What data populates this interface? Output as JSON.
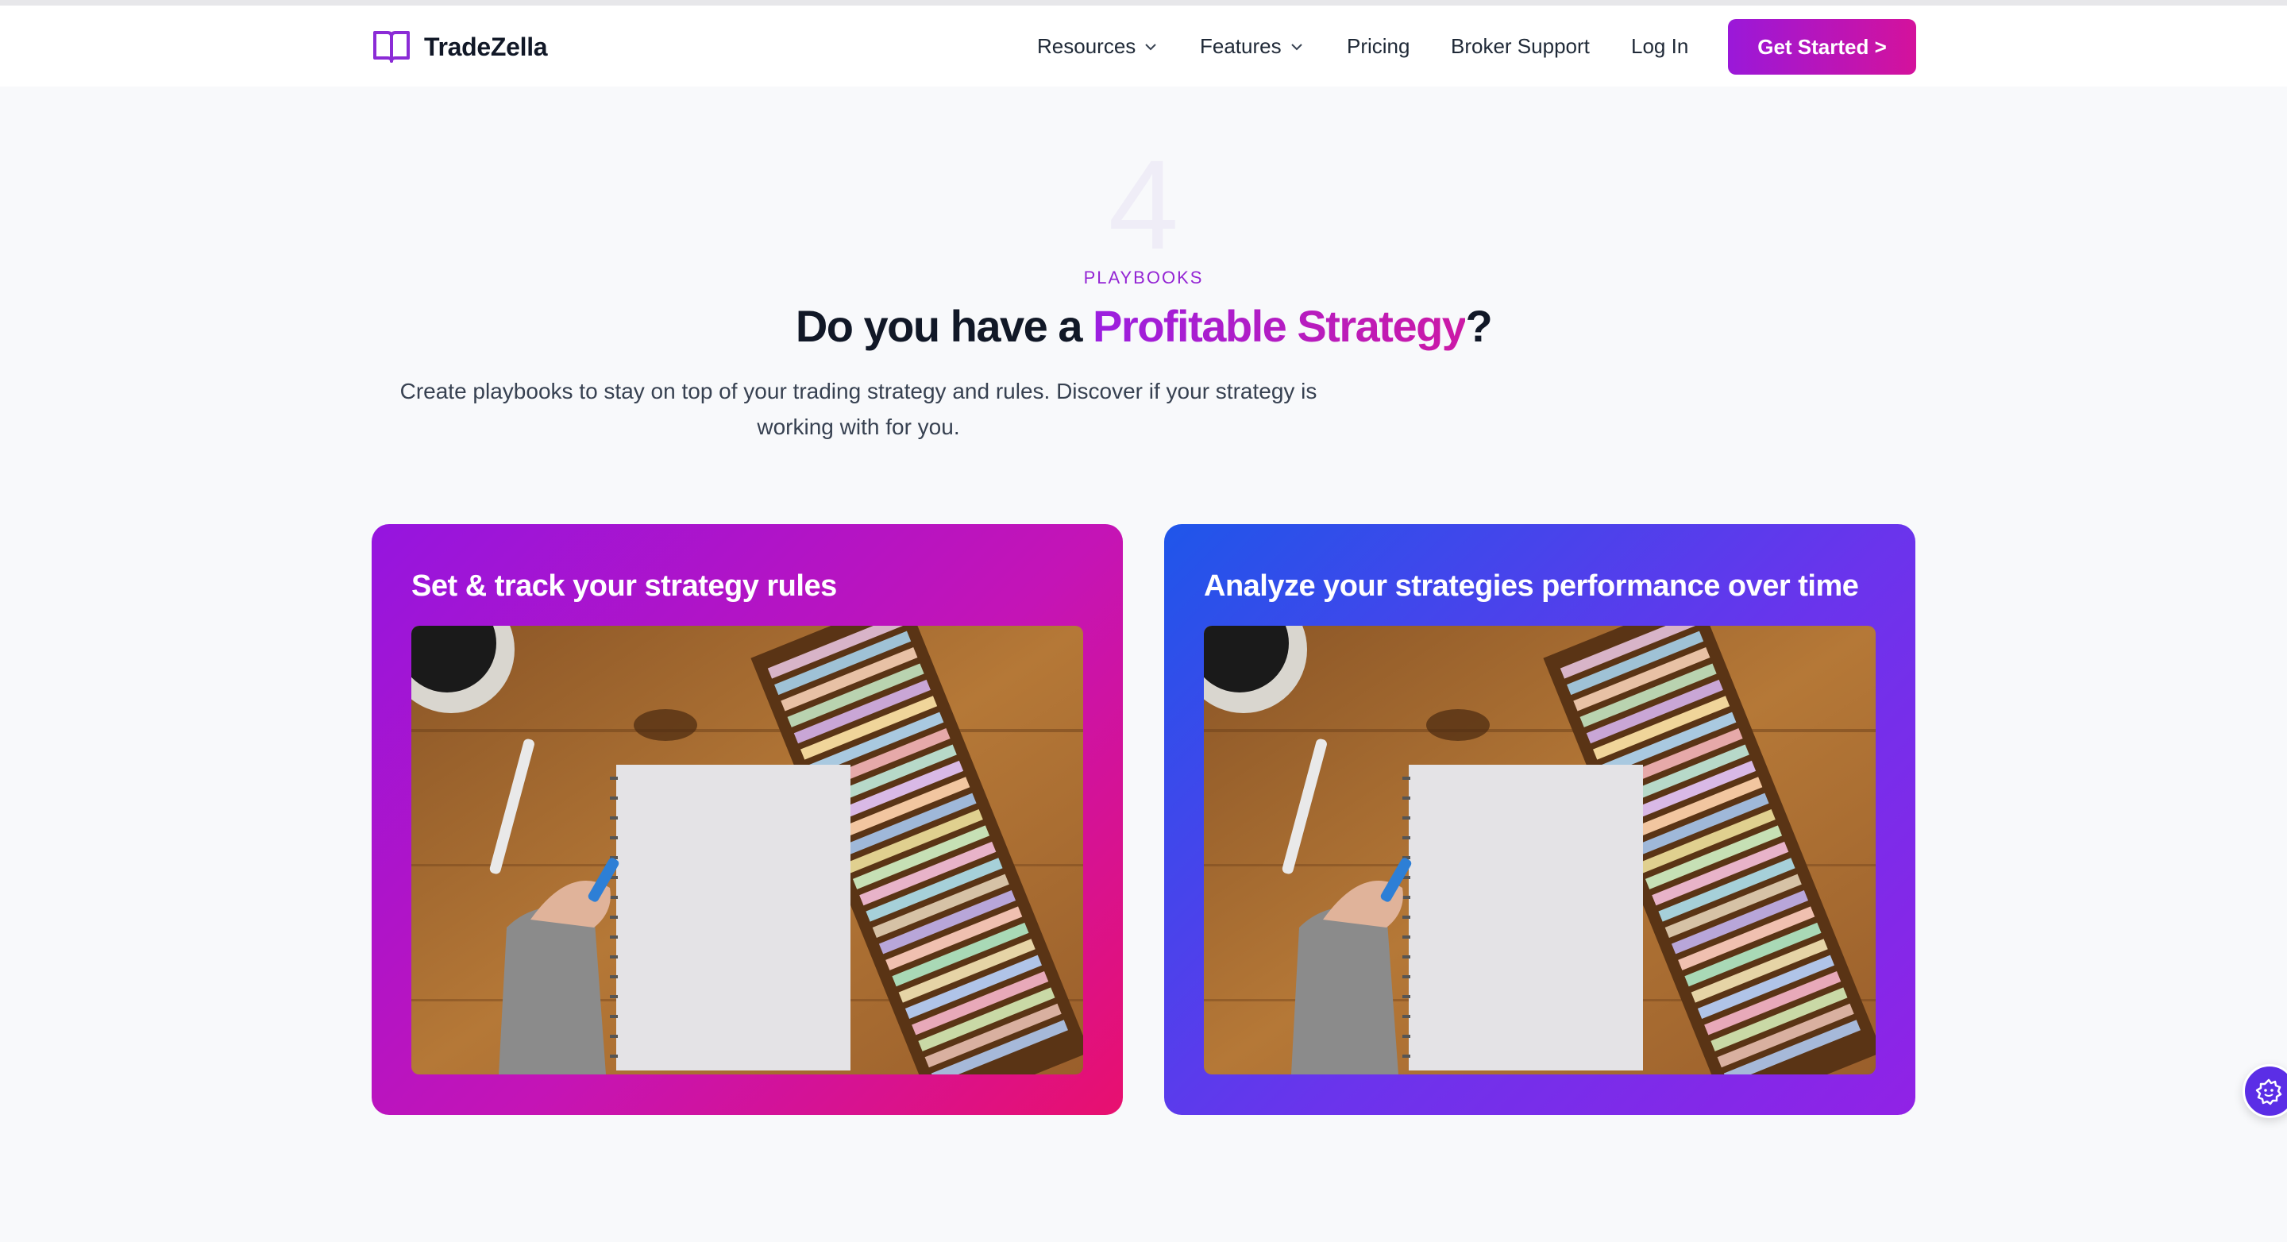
{
  "nav": {
    "brand": "TradeZella",
    "items": [
      {
        "label": "Resources",
        "has_dropdown": true
      },
      {
        "label": "Features",
        "has_dropdown": true
      },
      {
        "label": "Pricing",
        "has_dropdown": false
      },
      {
        "label": "Broker Support",
        "has_dropdown": false
      },
      {
        "label": "Log In",
        "has_dropdown": false
      }
    ],
    "cta_label": "Get Started >"
  },
  "section": {
    "number": "4",
    "eyebrow": "PLAYBOOKS",
    "headline_prefix": "Do you have a ",
    "headline_accent": "Profitable Strategy",
    "headline_suffix": "?",
    "description": "Create playbooks to stay on top of your trading strategy and rules. Discover if your strategy is working with for you."
  },
  "cards": [
    {
      "title": "Set & track your strategy rules",
      "image": "notebook-desk-photo"
    },
    {
      "title": "Analyze your strategies performance over time",
      "image": "notebook-desk-photo"
    }
  ],
  "icons": {
    "brand": "book-icon",
    "dropdown": "chevron-down-icon",
    "floating": "settings-badge-icon"
  },
  "colors": {
    "brand_purple": "#9a18d9",
    "brand_pink": "#d4129c",
    "card_left_gradient": [
      "#9515df",
      "#e8106f"
    ],
    "card_right_gradient": [
      "#1f56ea",
      "#9122e6"
    ]
  }
}
